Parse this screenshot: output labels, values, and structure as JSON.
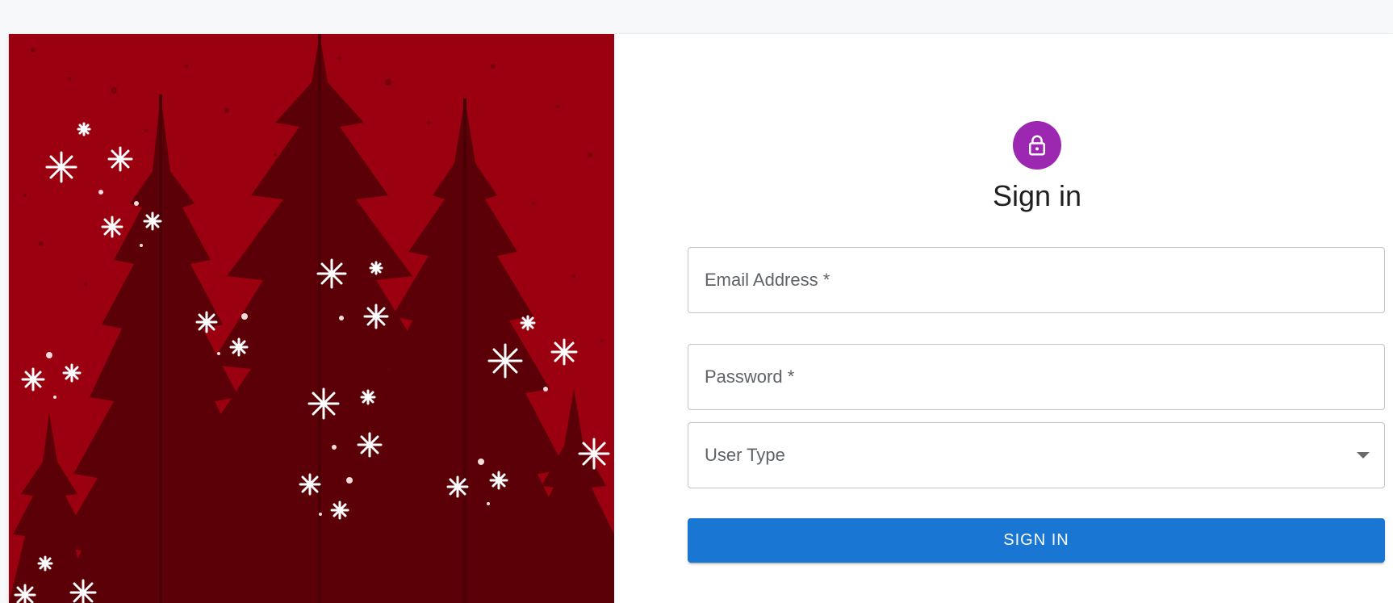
{
  "form": {
    "title": "Sign in",
    "email_label": "Email Address *",
    "password_label": "Password *",
    "user_type_label": "User Type",
    "submit_label": "SIGN IN"
  },
  "icons": {
    "avatar": "lock-icon",
    "select": "chevron-down-icon"
  },
  "colors": {
    "avatar_bg": "#9c27b0",
    "button_bg": "#1976d2",
    "image_red": "#9b0010",
    "tree_dark": "#5c0007"
  }
}
